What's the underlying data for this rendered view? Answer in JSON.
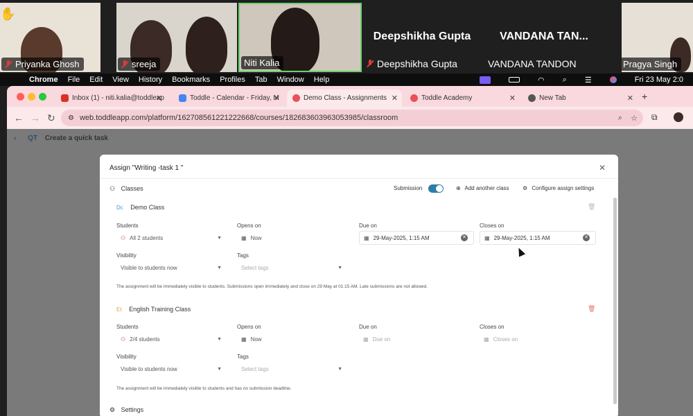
{
  "meeting": {
    "participants": [
      {
        "name": "Priyanka Ghosh"
      },
      {
        "name": "sreeja"
      },
      {
        "name": "Niti Kalia"
      },
      {
        "name": "Deepshikha Gupta",
        "display": "Deepshikha Gupta"
      },
      {
        "name": "VANDANA TANDON",
        "display": "VANDANA TAN..."
      },
      {
        "name": "Pragya Singh"
      }
    ],
    "active_speaker_color": "#6fcf6f"
  },
  "menubar": {
    "items": [
      "Chrome",
      "File",
      "Edit",
      "View",
      "History",
      "Bookmarks",
      "Profiles",
      "Tab",
      "Window",
      "Help"
    ],
    "clock": "Fri 23 May  2:0"
  },
  "browser": {
    "tabs": [
      {
        "title": "Inbox (1) - niti.kalia@toddleap",
        "icon": "gmail-icon",
        "color": "#d93025"
      },
      {
        "title": "Toddle - Calendar - Friday, M",
        "icon": "calendar-icon",
        "color": "#4285f4"
      },
      {
        "title": "Demo Class - Assignments",
        "icon": "toddle-icon",
        "color": "#e8505b",
        "active": true
      },
      {
        "title": "Toddle Academy",
        "icon": "toddle-icon",
        "color": "#e8505b"
      },
      {
        "title": "New Tab",
        "icon": "chrome-icon",
        "color": "#555555"
      }
    ],
    "url": "web.toddleapp.com/platform/162708561221222668/courses/182683603963053985/classroom"
  },
  "page": {
    "header_abbrev": "QT",
    "header_label": "Create a quick task"
  },
  "modal": {
    "title": "Assign \"Writing -task 1 \"",
    "section_classes": "Classes",
    "submission_label": "Submission",
    "submission_on": true,
    "add_class": "Add another class",
    "configure": "Configure assign settings",
    "settings_label": "Settings",
    "classes": [
      {
        "name": "Demo Class",
        "students_label": "Students",
        "students_value": "All 2 students",
        "opens_label": "Opens on",
        "opens_value": "Now",
        "due_label": "Due on",
        "due_value": "29-May-2025, 1:15 AM",
        "closes_label": "Closes on",
        "closes_value": "29-May-2025, 1:15 AM",
        "visibility_label": "Visibility",
        "visibility_value": "Visible to students now",
        "tags_label": "Tags",
        "tags_placeholder": "Select tags",
        "note": "The assignment will be immediately visible to students. Submissions open immediately and close on 29 May at 01:15 AM. Late submissions are not allowed."
      },
      {
        "name": "English Training Class",
        "students_label": "Students",
        "students_value": "2/4 students",
        "opens_label": "Opens on",
        "opens_value": "Now",
        "due_label": "Due on",
        "due_value": "Due on",
        "closes_label": "Closes on",
        "closes_value": "Closes on",
        "visibility_label": "Visibility",
        "visibility_value": "Visible to students now",
        "tags_label": "Tags",
        "tags_placeholder": "Select tags",
        "note": "The assignment will be immediately visible to students and has no submission deadline."
      }
    ]
  }
}
